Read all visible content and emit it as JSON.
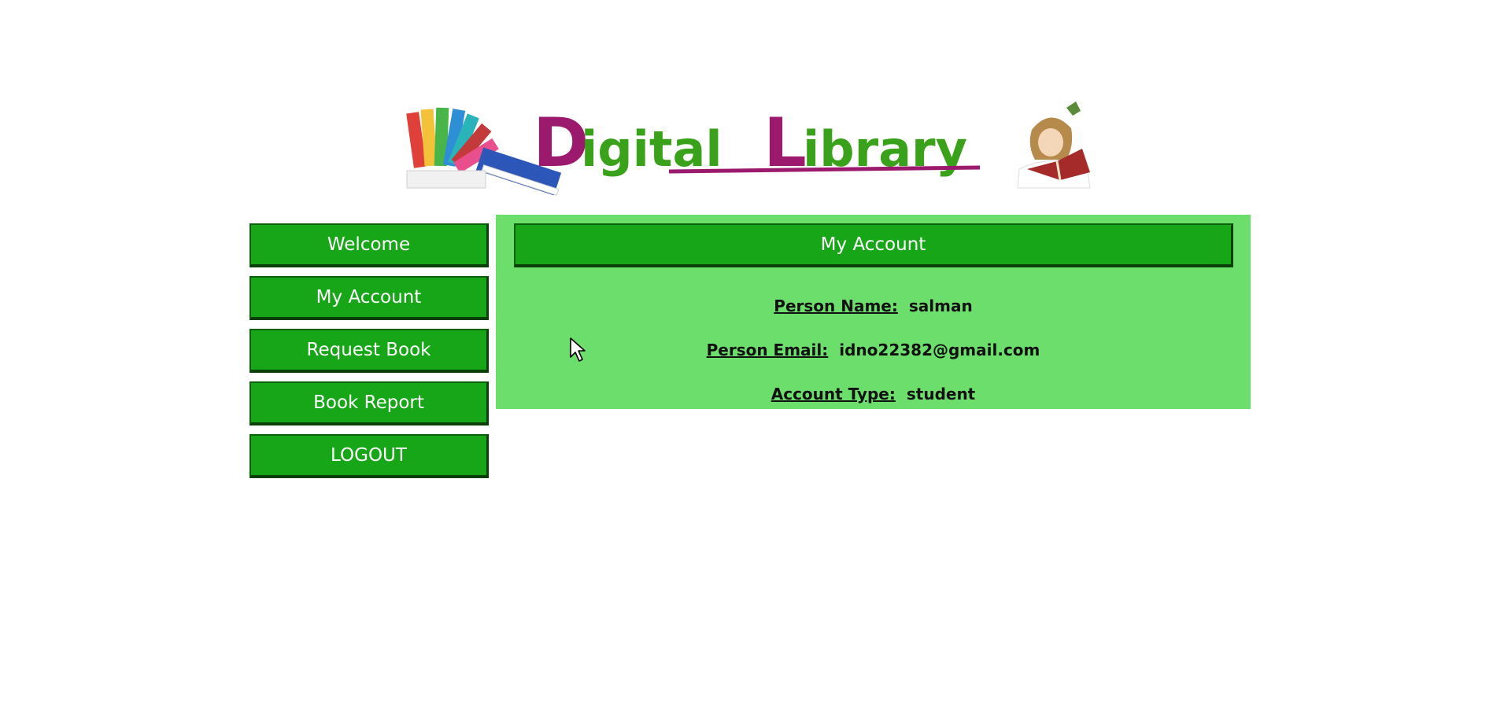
{
  "banner": {
    "logo_text": "DigitalLibrary"
  },
  "sidebar": {
    "items": [
      {
        "label": "Welcome"
      },
      {
        "label": "My Account"
      },
      {
        "label": "Request Book"
      },
      {
        "label": "Book Report"
      },
      {
        "label": "LOGOUT"
      }
    ]
  },
  "panel": {
    "title": "My Account",
    "fields": [
      {
        "label": "Person Name:",
        "value": "salman"
      },
      {
        "label": "Person Email:",
        "value": "idno22382@gmail.com"
      },
      {
        "label": "Account Type:",
        "value": "student"
      }
    ]
  },
  "colors": {
    "button_green": "#17a617",
    "panel_green": "#6cde6c",
    "logo_purple": "#9c1a6e",
    "logo_green": "#3aa21a"
  },
  "icons": {
    "cursor": "mouse-pointer-icon"
  }
}
